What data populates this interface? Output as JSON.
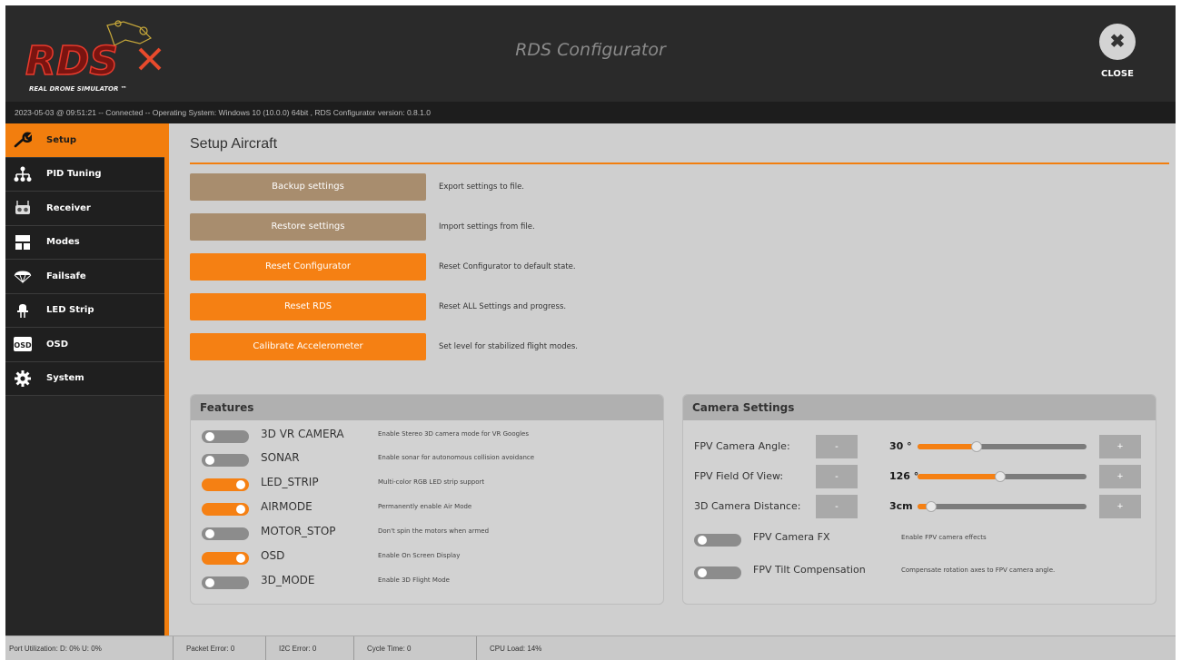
{
  "header": {
    "title": "RDS Configurator",
    "close_label": "CLOSE",
    "logo_text": "RDS",
    "logo_sub": "REAL DRONE SIMULATOR ™"
  },
  "status_line": "2023-05-03 @ 09:51:21 -- Connected -- Operating System: Windows 10 (10.0.0) 64bit , RDS Configurator version: 0.8.1.0",
  "sidebar": {
    "items": [
      {
        "label": "Setup",
        "icon": "wrench-icon",
        "active": true
      },
      {
        "label": "PID Tuning",
        "icon": "network-icon",
        "active": false
      },
      {
        "label": "Receiver",
        "icon": "transmitter-icon",
        "active": false
      },
      {
        "label": "Modes",
        "icon": "modes-icon",
        "active": false
      },
      {
        "label": "Failsafe",
        "icon": "parachute-icon",
        "active": false
      },
      {
        "label": "LED Strip",
        "icon": "led-icon",
        "active": false
      },
      {
        "label": "OSD",
        "icon": "osd-icon",
        "active": false
      },
      {
        "label": "System",
        "icon": "gear-icon",
        "active": false
      }
    ]
  },
  "main": {
    "title": "Setup Aircraft",
    "actions": [
      {
        "label": "Backup settings",
        "desc": "Export settings to file.",
        "style": "brown"
      },
      {
        "label": "Restore settings",
        "desc": "Import settings from file.",
        "style": "brown"
      },
      {
        "label": "Reset Configurator",
        "desc": "Reset Configurator to default state.",
        "style": "orange"
      },
      {
        "label": "Reset RDS",
        "desc": "Reset ALL Settings and progress.",
        "style": "orange"
      },
      {
        "label": "Calibrate Accelerometer",
        "desc": "Set level for stabilized flight modes.",
        "style": "orange"
      }
    ]
  },
  "features": {
    "title": "Features",
    "items": [
      {
        "name": "3D VR CAMERA",
        "desc": "Enable Stereo 3D camera mode for VR Googles",
        "on": false
      },
      {
        "name": "SONAR",
        "desc": "Enable sonar for autonomous collision avoidance",
        "on": false
      },
      {
        "name": "LED_STRIP",
        "desc": "Multi-color RGB LED strip support",
        "on": true
      },
      {
        "name": "AIRMODE",
        "desc": "Permanently enable Air Mode",
        "on": true
      },
      {
        "name": "MOTOR_STOP",
        "desc": "Don't spin the motors when armed",
        "on": false
      },
      {
        "name": "OSD",
        "desc": "Enable On Screen Display",
        "on": true
      },
      {
        "name": "3D_MODE",
        "desc": "Enable 3D Flight Mode",
        "on": false
      }
    ]
  },
  "camera": {
    "title": "Camera Settings",
    "minus_label": "-",
    "plus_label": "+",
    "rows": [
      {
        "label": "FPV Camera Angle:",
        "value": "30 °",
        "level": 0.35
      },
      {
        "label": "FPV Field Of View:",
        "value": "126 °",
        "level": 0.49
      },
      {
        "label": "3D Camera Distance:",
        "value": "3cm",
        "level": 0.08
      }
    ],
    "toggles": [
      {
        "name": "FPV Camera FX",
        "desc": "Enable FPV camera effects",
        "on": false
      },
      {
        "name": "FPV Tilt Compensation",
        "desc": "Compensate rotation axes to FPV camera angle.",
        "on": false
      }
    ]
  },
  "bottom_bar": {
    "port": "Port Utilization: D: 0% U: 0%",
    "packet": "Packet Error: 0",
    "i2c": "I2C Error: 0",
    "cycle": "Cycle Time: 0",
    "cpu": "CPU Load: 14%"
  },
  "colors": {
    "accent": "#f58013",
    "brown_button": "#a88d6e",
    "sidebar_bg": "#1f1f1f",
    "header_bg": "#2a2a2a"
  }
}
